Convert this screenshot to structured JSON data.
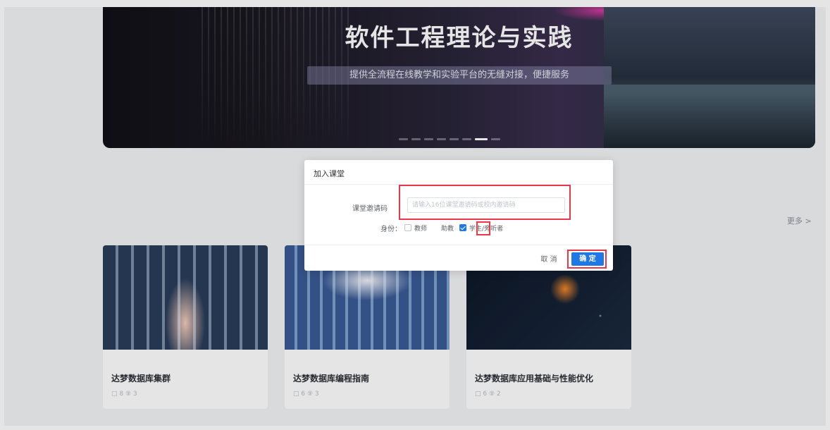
{
  "banner": {
    "title": "软件工程理论与实践",
    "subtitle": "提供全流程在线教学和实验平台的无缝对接，便捷服务",
    "slide_count": 8,
    "active_slide": 7
  },
  "section": {
    "more_label": "更多 >"
  },
  "courses": [
    {
      "title": "达梦数据库集群",
      "meta": "□ 8  ⑨ 3"
    },
    {
      "title": "达梦数据库编程指南",
      "meta": "□ 6  ⑨ 3"
    },
    {
      "title": "达梦数据库应用基础与性能优化",
      "meta": "□ 6  ⑨ 2"
    }
  ],
  "dialog": {
    "title": "加入课堂",
    "invite_label": "课堂邀请码",
    "invite_placeholder": "请输入16位课堂邀请码或校内邀请码",
    "identity_label": "身份：",
    "options": [
      {
        "label": "教师",
        "checked": false
      },
      {
        "label": "助教",
        "checked": false
      },
      {
        "label": "学生/旁听者",
        "checked": true
      }
    ],
    "cancel_label": "取 消",
    "confirm_label": "确 定"
  },
  "colors": {
    "primary": "#1f78e6",
    "highlight": "#e8384a"
  }
}
